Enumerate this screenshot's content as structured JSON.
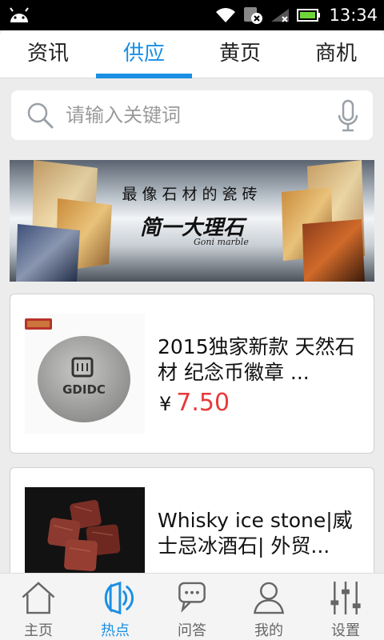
{
  "status_bar": {
    "time": "13:34",
    "icons": [
      "android-icon",
      "wifi-icon",
      "notification-icon",
      "signal-icon",
      "battery-icon"
    ]
  },
  "tabs": [
    {
      "label": "资讯",
      "active": false
    },
    {
      "label": "供应",
      "active": true
    },
    {
      "label": "黄页",
      "active": false
    },
    {
      "label": "商机",
      "active": false
    }
  ],
  "search": {
    "placeholder": "请输入关键词"
  },
  "banner": {
    "line1": "最像石材的瓷砖",
    "line2": "简一大理石",
    "line3": "Goni marble"
  },
  "products": [
    {
      "title": "2015独家新款 天然石材 纪念币徽章 ...",
      "currency": "¥",
      "price": "7.50",
      "badge_text": "GDIDC"
    },
    {
      "title": "Whisky ice stone|威士忌冰酒石| 外贸..."
    }
  ],
  "bottom_nav": [
    {
      "label": "主页",
      "icon": "home-icon",
      "active": false
    },
    {
      "label": "热点",
      "icon": "speaker-icon",
      "active": true
    },
    {
      "label": "问答",
      "icon": "chat-icon",
      "active": false
    },
    {
      "label": "我的",
      "icon": "user-icon",
      "active": false
    },
    {
      "label": "设置",
      "icon": "settings-sliders-icon",
      "active": false
    }
  ],
  "colors": {
    "accent": "#1a8fe3",
    "price": "#e63a3a",
    "background": "#ececec"
  }
}
